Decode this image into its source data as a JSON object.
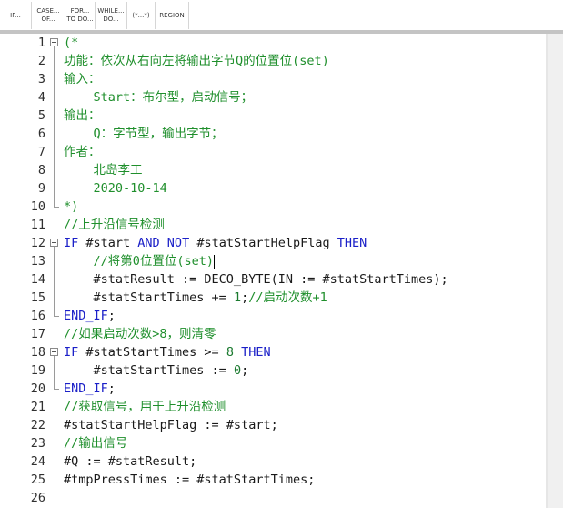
{
  "toolbar": {
    "buttons": [
      {
        "label": "IF..."
      },
      {
        "label": "CASE...\nOF..."
      },
      {
        "label": "FOR...\nTO DO..."
      },
      {
        "label": "WHILE...\nDO..."
      },
      {
        "label": "(*...*)"
      },
      {
        "label": "REGION"
      }
    ]
  },
  "editor": {
    "lines": [
      {
        "n": "1",
        "segs": [
          {
            "t": "(*",
            "c": "comment"
          }
        ]
      },
      {
        "n": "2",
        "segs": [
          {
            "t": "功能：依次从右向左将输出字节Q的位置位(set)",
            "c": "comment"
          }
        ]
      },
      {
        "n": "3",
        "segs": [
          {
            "t": "输入：",
            "c": "comment"
          }
        ]
      },
      {
        "n": "4",
        "segs": [
          {
            "t": "    Start：布尔型，启动信号；",
            "c": "comment"
          }
        ]
      },
      {
        "n": "5",
        "segs": [
          {
            "t": "输出：",
            "c": "comment"
          }
        ]
      },
      {
        "n": "6",
        "segs": [
          {
            "t": "    Q：字节型，输出字节；",
            "c": "comment"
          }
        ]
      },
      {
        "n": "7",
        "segs": [
          {
            "t": "作者：",
            "c": "comment"
          }
        ]
      },
      {
        "n": "8",
        "segs": [
          {
            "t": "    北岛李工",
            "c": "comment"
          }
        ]
      },
      {
        "n": "9",
        "segs": [
          {
            "t": "    2020-10-14",
            "c": "comment"
          }
        ]
      },
      {
        "n": "10",
        "segs": [
          {
            "t": "*)",
            "c": "comment"
          }
        ]
      },
      {
        "n": "11",
        "segs": [
          {
            "t": "//上升沿信号检测",
            "c": "comment"
          }
        ]
      },
      {
        "n": "12",
        "segs": [
          {
            "t": "IF ",
            "c": "kw"
          },
          {
            "t": "#start ",
            "c": "var"
          },
          {
            "t": "AND NOT ",
            "c": "kw"
          },
          {
            "t": "#statStartHelpFlag ",
            "c": "var"
          },
          {
            "t": "THEN",
            "c": "kw"
          }
        ]
      },
      {
        "n": "13",
        "segs": [
          {
            "t": "    //将第0位置位(set)",
            "c": "comment"
          }
        ]
      },
      {
        "n": "14",
        "segs": [
          {
            "t": "    #statResult := DECO_BYTE(IN := #statStartTimes);",
            "c": "var"
          }
        ]
      },
      {
        "n": "15",
        "segs": [
          {
            "t": "    #statStartTimes += ",
            "c": "var"
          },
          {
            "t": "1",
            "c": "num"
          },
          {
            "t": ";",
            "c": "var"
          },
          {
            "t": "//启动次数+1",
            "c": "comment"
          }
        ]
      },
      {
        "n": "16",
        "segs": [
          {
            "t": "END_IF",
            "c": "kw"
          },
          {
            "t": ";",
            "c": "var"
          }
        ]
      },
      {
        "n": "17",
        "segs": [
          {
            "t": "//如果启动次数>8，则清零",
            "c": "comment"
          }
        ]
      },
      {
        "n": "18",
        "segs": [
          {
            "t": "IF ",
            "c": "kw"
          },
          {
            "t": "#statStartTimes >= ",
            "c": "var"
          },
          {
            "t": "8 ",
            "c": "num"
          },
          {
            "t": "THEN",
            "c": "kw"
          }
        ]
      },
      {
        "n": "19",
        "segs": [
          {
            "t": "    #statStartTimes := ",
            "c": "var"
          },
          {
            "t": "0",
            "c": "num"
          },
          {
            "t": ";",
            "c": "var"
          }
        ]
      },
      {
        "n": "20",
        "segs": [
          {
            "t": "END_IF",
            "c": "kw"
          },
          {
            "t": ";",
            "c": "var"
          }
        ]
      },
      {
        "n": "21",
        "segs": [
          {
            "t": "//获取信号，用于上升沿检测",
            "c": "comment"
          }
        ]
      },
      {
        "n": "22",
        "segs": [
          {
            "t": "#statStartHelpFlag := #start;",
            "c": "var"
          }
        ]
      },
      {
        "n": "23",
        "segs": [
          {
            "t": "//输出信号",
            "c": "comment"
          }
        ]
      },
      {
        "n": "24",
        "segs": [
          {
            "t": "#Q := #statResult;",
            "c": "var"
          }
        ]
      },
      {
        "n": "25",
        "segs": [
          {
            "t": "#tmpPressTimes := #statStartTimes;",
            "c": "var"
          }
        ]
      },
      {
        "n": "26",
        "segs": []
      }
    ]
  }
}
